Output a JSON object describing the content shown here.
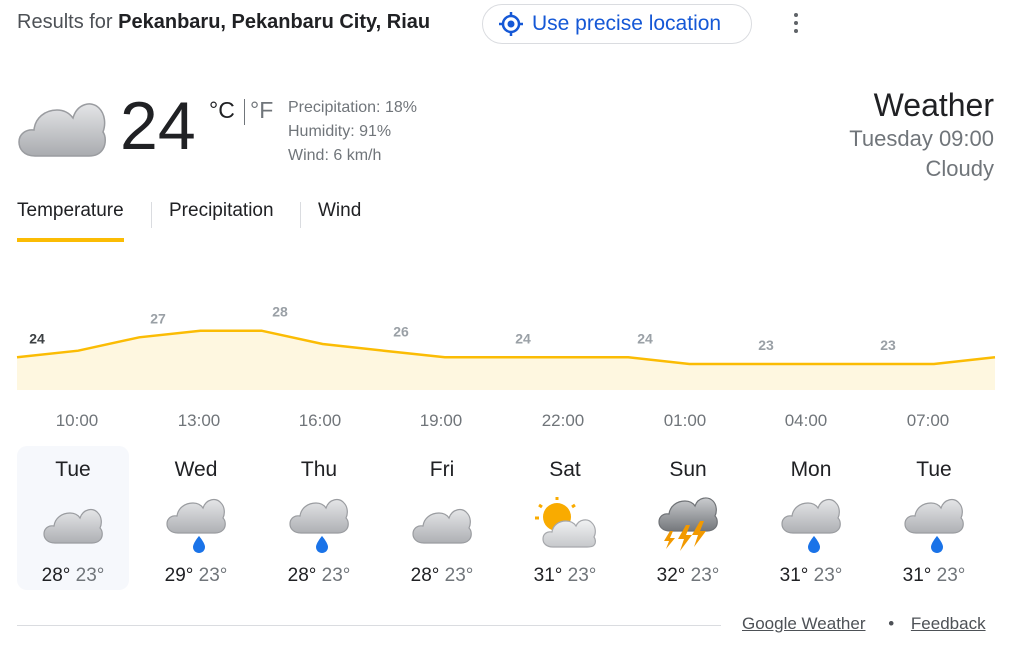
{
  "header": {
    "results_prefix": "Results for",
    "location": "Pekanbaru, Pekanbaru City, Riau",
    "precise_location_label": "Use precise location"
  },
  "current": {
    "icon": "cloudy-icon",
    "temperature": "24",
    "unit_c": "°C",
    "unit_f": "°F",
    "precipitation": "Precipitation: 18%",
    "humidity": "Humidity: 91%",
    "wind": "Wind: 6 km/h",
    "title": "Weather",
    "datetime": "Tuesday 09:00",
    "condition": "Cloudy"
  },
  "tabs": [
    {
      "label": "Temperature",
      "active": true
    },
    {
      "label": "Precipitation",
      "active": false
    },
    {
      "label": "Wind",
      "active": false
    }
  ],
  "chart_data": {
    "type": "area",
    "x": [
      "10:00",
      "13:00",
      "16:00",
      "19:00",
      "22:00",
      "01:00",
      "04:00",
      "07:00"
    ],
    "labels_x": [
      "10:00",
      "13:00",
      "16:00",
      "19:00",
      "22:00",
      "01:00",
      "04:00",
      "07:00"
    ],
    "point_labels": [
      "24",
      "27",
      "28",
      "26",
      "24",
      "24",
      "23",
      "23"
    ],
    "series": [
      {
        "values": [
          24,
          25,
          27,
          28,
          28,
          26,
          25,
          24,
          24,
          24,
          24,
          23,
          23,
          23,
          23,
          23,
          24
        ]
      }
    ],
    "fill_color": "#fef7e0",
    "line_color": "#fbbc04",
    "ylim": [
      20,
      32
    ]
  },
  "forecast": [
    {
      "day": "Tue",
      "icon": "cloudy-icon",
      "high": "28°",
      "low": "23°",
      "selected": true
    },
    {
      "day": "Wed",
      "icon": "rain-icon",
      "high": "29°",
      "low": "23°",
      "selected": false
    },
    {
      "day": "Thu",
      "icon": "rain-icon",
      "high": "28°",
      "low": "23°",
      "selected": false
    },
    {
      "day": "Fri",
      "icon": "cloudy-icon",
      "high": "28°",
      "low": "23°",
      "selected": false
    },
    {
      "day": "Sat",
      "icon": "partly-cloudy-icon",
      "high": "31°",
      "low": "23°",
      "selected": false
    },
    {
      "day": "Sun",
      "icon": "thunderstorm-icon",
      "high": "32°",
      "low": "23°",
      "selected": false
    },
    {
      "day": "Mon",
      "icon": "rain-icon",
      "high": "31°",
      "low": "23°",
      "selected": false
    },
    {
      "day": "Tue",
      "icon": "rain-icon",
      "high": "31°",
      "low": "23°",
      "selected": false
    }
  ],
  "footer": {
    "source_link": "Google Weather",
    "separator": "•",
    "feedback_link": "Feedback"
  },
  "colors": {
    "accent": "#fbbc04",
    "link": "#1558d6",
    "cloud": "#c7c9cc",
    "rain_drop": "#1a73e8",
    "sun": "#f9ab00",
    "bolt": "#f29900"
  }
}
